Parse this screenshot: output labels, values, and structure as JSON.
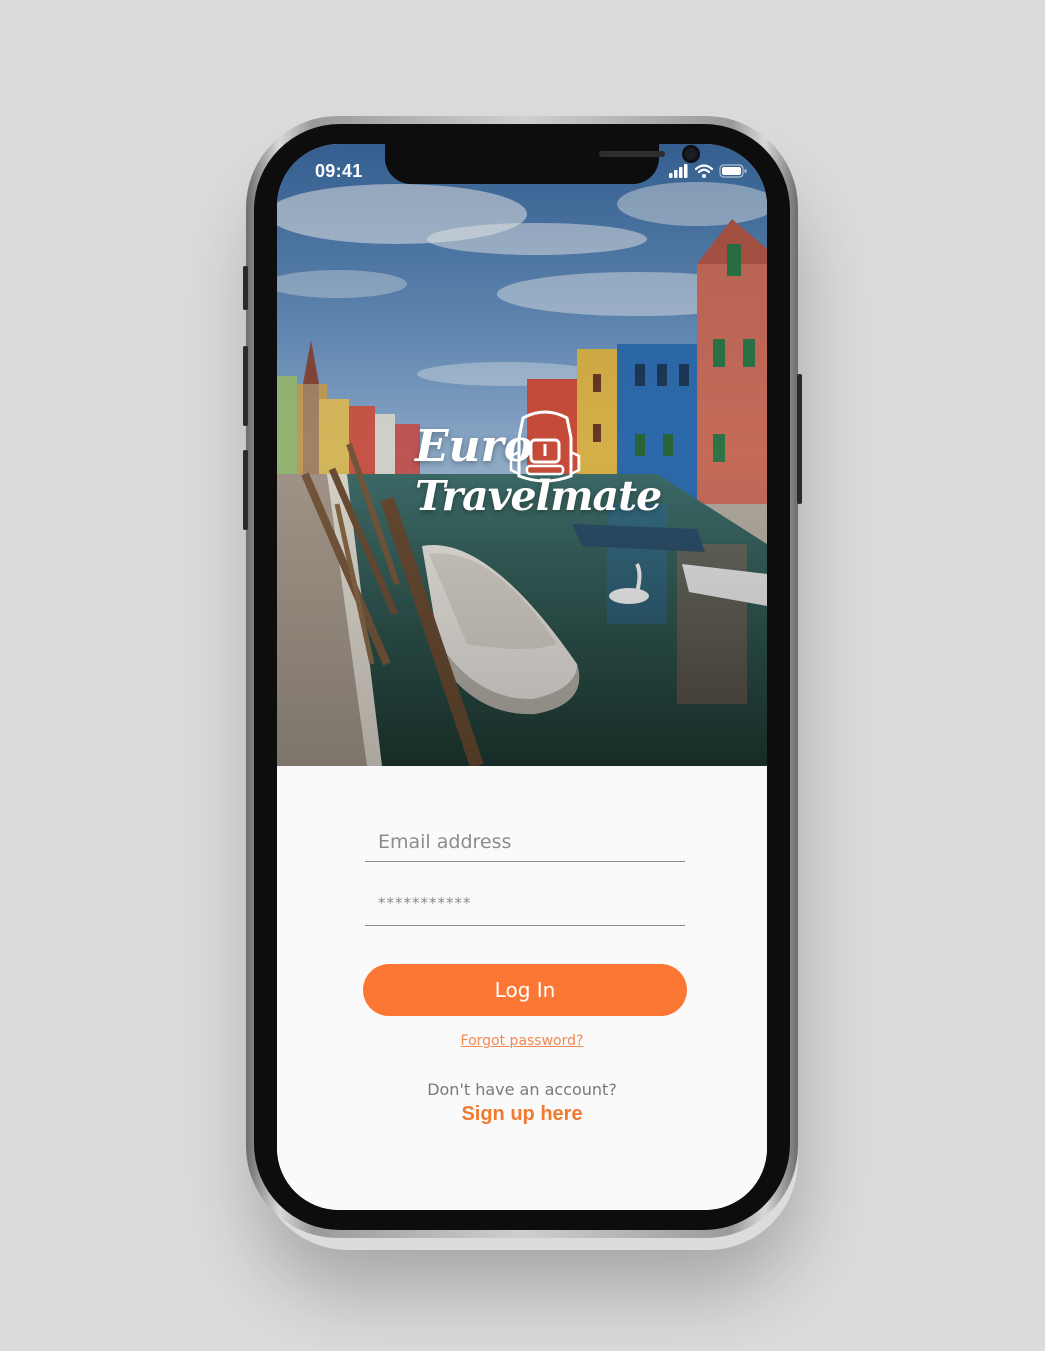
{
  "status_bar": {
    "time": "09:41",
    "icons": [
      "signal-icon",
      "wifi-icon",
      "battery-icon"
    ]
  },
  "hero": {
    "logo_line1": "Euro",
    "logo_line2": "Travelmate",
    "logo_icon": "backpack-icon"
  },
  "login_form": {
    "email_placeholder": "Email address",
    "password_placeholder": "***********",
    "login_button": "Log In",
    "forgot_password": "Forgot password?",
    "no_account_text": "Don't have an account?",
    "signup_link": "Sign up here"
  },
  "colors": {
    "accent": "#fd7734",
    "background": "#dcdcdc",
    "form_background": "#fafafa"
  }
}
